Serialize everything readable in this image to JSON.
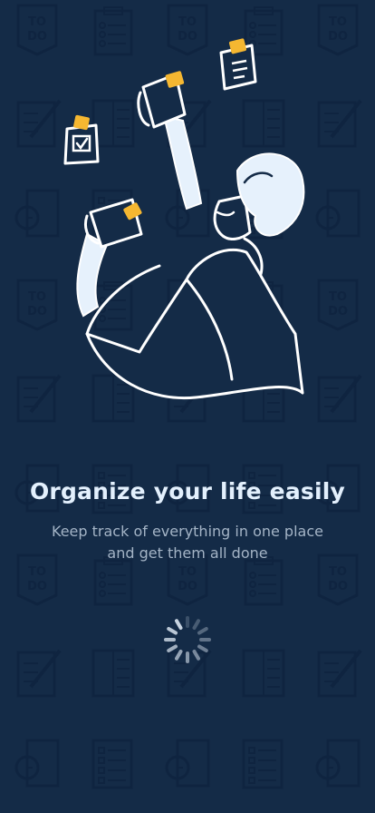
{
  "background": {
    "color": "#142b47",
    "pattern_color": "#0f2440",
    "pattern_stamp_text": "TO DO",
    "pattern_icons": [
      "todo-stamp-icon",
      "checklist-icon",
      "notepad-pencil-icon",
      "clipboard-icon",
      "clock-icon",
      "planner-icon"
    ]
  },
  "illustration": {
    "icon": "person-juggling-notes-illustration",
    "line_color": "#ffffff",
    "fill_color": "#e6f1fc",
    "accent_color": "#f5b731"
  },
  "onboarding": {
    "title": "Organize your life easily",
    "subtitle_line1": "Keep track of everything in one place",
    "subtitle_line2": "and get them all done"
  },
  "loading": {
    "icon": "loading-spinner-icon",
    "color": "#c7d3e0"
  }
}
